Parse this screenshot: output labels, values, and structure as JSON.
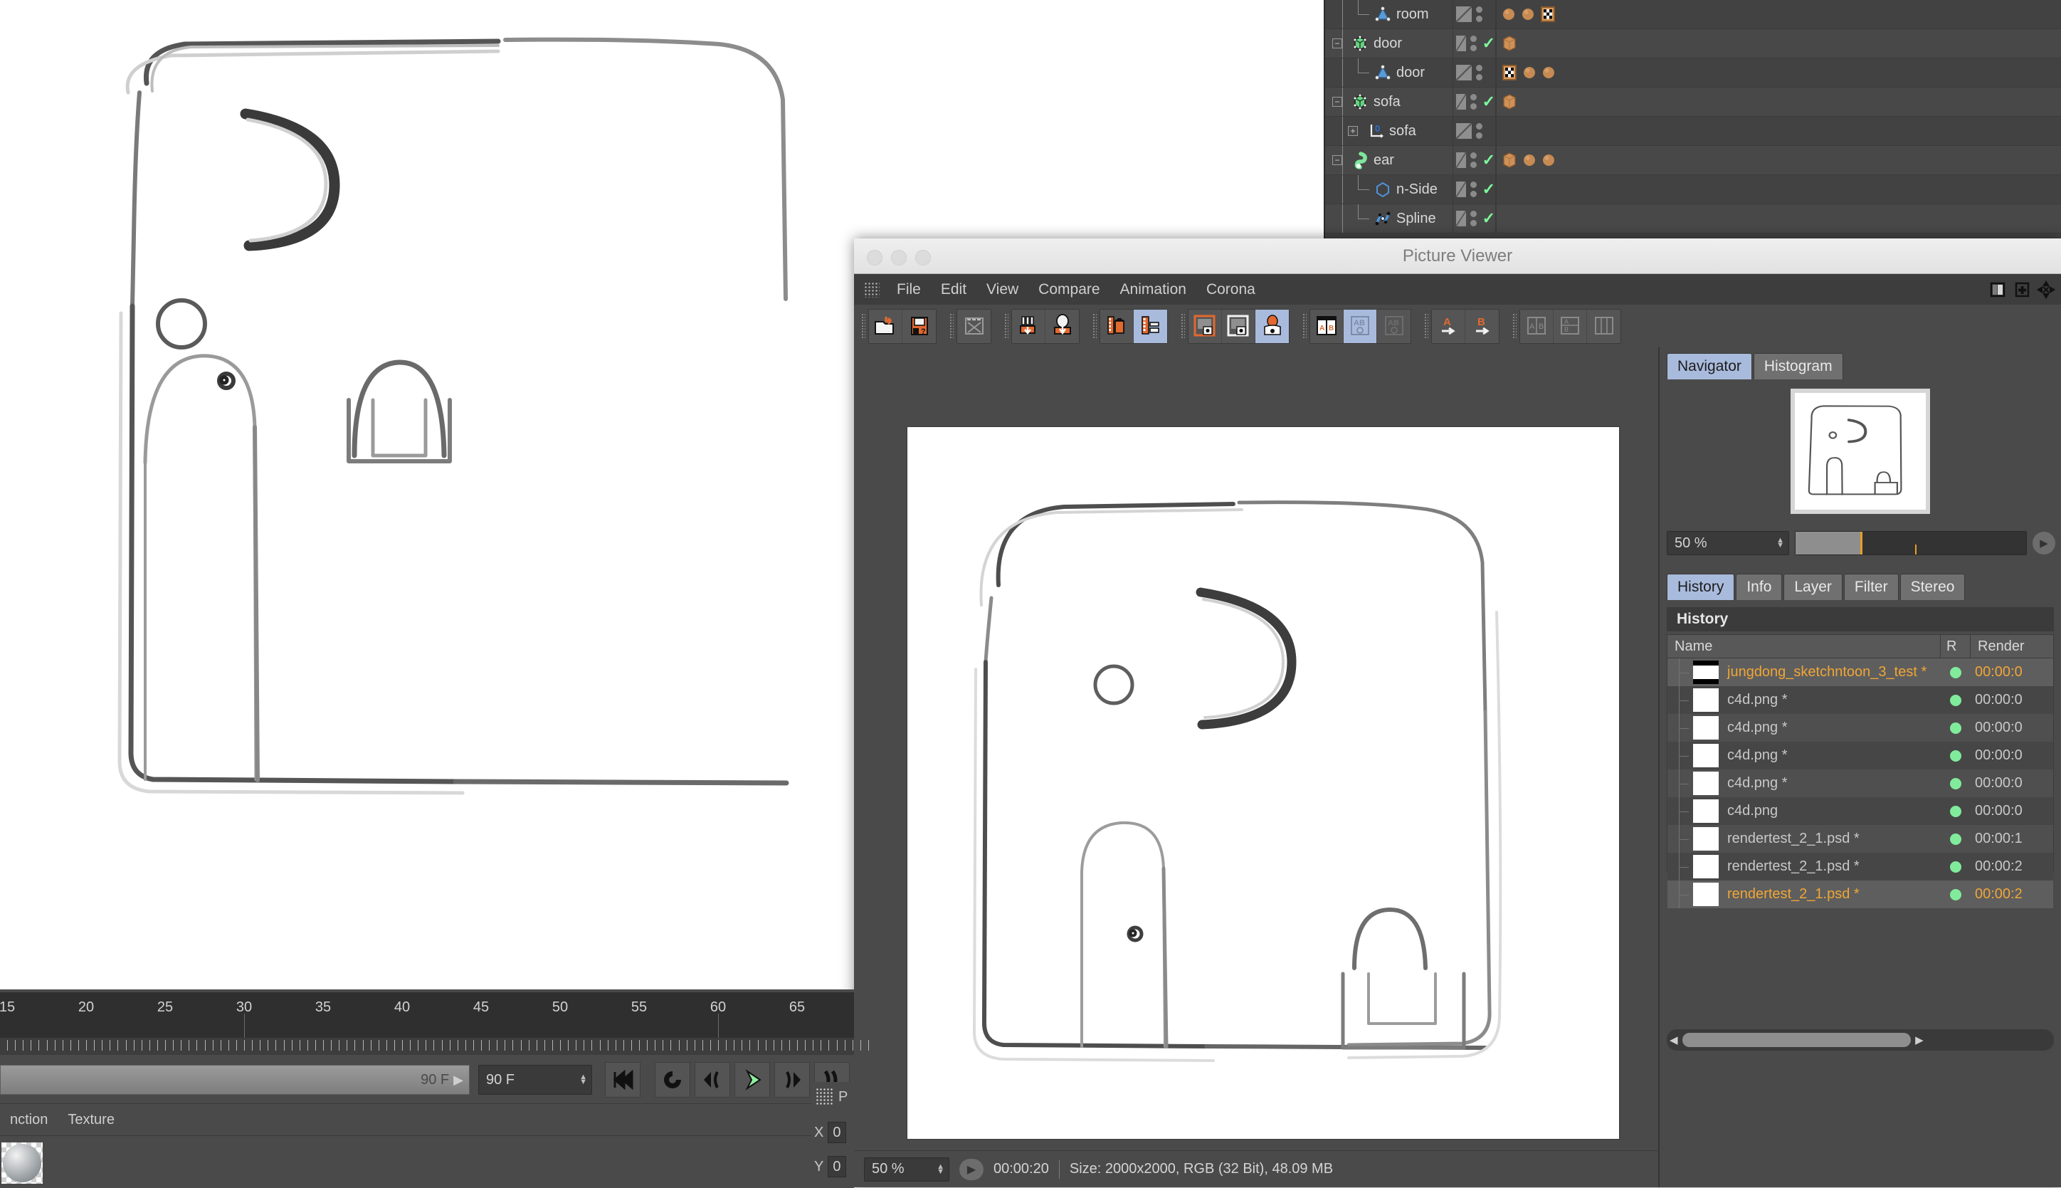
{
  "object_manager": {
    "rows": [
      {
        "label": "room",
        "depth": 2,
        "icon": "polygon-object-icon",
        "expander": "none",
        "check": false,
        "tags": [
          "material-tag",
          "material-tag",
          "texture-checker-tag"
        ]
      },
      {
        "label": "door",
        "depth": 1,
        "icon": "cube-object-icon",
        "expander": "minus",
        "check": true,
        "tags": [
          "texture-cube-tag"
        ]
      },
      {
        "label": "door",
        "depth": 2,
        "icon": "polygon-object-icon",
        "expander": "none",
        "check": false,
        "tags": [
          "texture-checker-tag",
          "material-tag",
          "material-tag"
        ]
      },
      {
        "label": "sofa",
        "depth": 1,
        "icon": "cube-object-icon",
        "expander": "minus",
        "check": true,
        "tags": [
          "texture-cube-tag"
        ]
      },
      {
        "label": "sofa",
        "depth": 2,
        "icon": "null-axis-object-icon",
        "expander": "plus",
        "check": false,
        "tags": []
      },
      {
        "label": "ear",
        "depth": 1,
        "icon": "sweep-object-icon",
        "expander": "minus",
        "check": true,
        "tags": [
          "texture-cube-tag",
          "material-tag",
          "material-tag"
        ]
      },
      {
        "label": "n-Side",
        "depth": 2,
        "icon": "ngon-spline-icon",
        "expander": "none",
        "check": true,
        "tags": []
      },
      {
        "label": "Spline",
        "depth": 2,
        "icon": "spline-object-icon",
        "expander": "none",
        "check": true,
        "tags": []
      }
    ]
  },
  "picture_viewer": {
    "title": "Picture Viewer",
    "menu": [
      "File",
      "Edit",
      "View",
      "Compare",
      "Animation",
      "Corona"
    ],
    "window_right_icons": [
      "split-panel-icon",
      "add-panel-icon",
      "move-panel-icon"
    ],
    "toolbar_groups": [
      {
        "buttons": [
          {
            "name": "open-image-icon",
            "selected": false
          },
          {
            "name": "save-image-icon",
            "selected": false
          }
        ]
      },
      {
        "buttons": [
          {
            "name": "render-region-icon",
            "selected": false
          }
        ]
      },
      {
        "buttons": [
          {
            "name": "load-ab-icon",
            "selected": false
          },
          {
            "name": "load-b-icon",
            "selected": false
          }
        ]
      },
      {
        "buttons": [
          {
            "name": "filmstrip-delete-icon",
            "selected": false
          },
          {
            "name": "filmstrip-edit-icon",
            "selected": true
          }
        ]
      },
      {
        "buttons": [
          {
            "name": "view-fit-icon",
            "selected": false
          },
          {
            "name": "view-original-icon",
            "selected": false
          },
          {
            "name": "view-color-icon",
            "selected": true
          }
        ]
      },
      {
        "buttons": [
          {
            "name": "compare-ab-icon",
            "selected": false
          },
          {
            "name": "compare-ab-blend-icon",
            "selected": true
          },
          {
            "name": "compare-ab-diff-icon",
            "selected": false
          }
        ]
      },
      {
        "buttons": [
          {
            "name": "set-a-icon",
            "selected": false
          },
          {
            "name": "set-b-icon",
            "selected": false
          }
        ]
      },
      {
        "buttons": [
          {
            "name": "layer-a-icon",
            "selected": false
          },
          {
            "name": "layer-b-icon",
            "selected": false
          },
          {
            "name": "layer-c-icon",
            "selected": false
          }
        ]
      }
    ],
    "status": {
      "zoom": "50 %",
      "play_icon": "play-icon",
      "time": "00:00:20",
      "info": "Size: 2000x2000, RGB (32 Bit), 48.09 MB"
    },
    "right_dock": {
      "view_tabs": [
        {
          "label": "Navigator",
          "active": true
        },
        {
          "label": "Histogram",
          "active": false
        }
      ],
      "navigator": {
        "zoom": "50 %",
        "next_icon": "arrow-right-icon"
      },
      "panel_tabs": [
        {
          "label": "History",
          "active": true
        },
        {
          "label": "Info",
          "active": false
        },
        {
          "label": "Layer",
          "active": false
        },
        {
          "label": "Filter",
          "active": false
        },
        {
          "label": "Stereo",
          "active": false
        }
      ],
      "history": {
        "section_title": "History",
        "columns": [
          "Name",
          "R",
          "Render"
        ],
        "rows": [
          {
            "name": "jungdong_sketchntoon_3_test *",
            "r": "green",
            "render": "00:00:0",
            "selected": true,
            "thumb": "blackbars"
          },
          {
            "name": "c4d.png *",
            "r": "green",
            "render": "00:00:0",
            "selected": false,
            "thumb": "plain"
          },
          {
            "name": "c4d.png *",
            "r": "green",
            "render": "00:00:0",
            "selected": false,
            "thumb": "plain"
          },
          {
            "name": "c4d.png *",
            "r": "green",
            "render": "00:00:0",
            "selected": false,
            "thumb": "plain"
          },
          {
            "name": "c4d.png *",
            "r": "green",
            "render": "00:00:0",
            "selected": false,
            "thumb": "plain"
          },
          {
            "name": "c4d.png",
            "r": "green",
            "render": "00:00:0",
            "selected": false,
            "thumb": "plain"
          },
          {
            "name": "rendertest_2_1.psd *",
            "r": "green",
            "render": "00:00:1",
            "selected": false,
            "thumb": "plain"
          },
          {
            "name": "rendertest_2_1.psd *",
            "r": "green",
            "render": "00:00:2",
            "selected": false,
            "thumb": "plain"
          },
          {
            "name": "rendertest_2_1.psd *",
            "r": "green",
            "render": "00:00:2",
            "selected": true,
            "thumb": "plain"
          }
        ]
      }
    }
  },
  "timeline": {
    "labels": [
      "15",
      "20",
      "25",
      "30",
      "35",
      "40",
      "45",
      "50",
      "55",
      "60",
      "65"
    ],
    "range_label": "90 F",
    "frame_field": "90 F",
    "transport": [
      "go-to-start-icon",
      "loop-icon",
      "step-back-icon",
      "play-icon",
      "step-forward-icon",
      "go-to-end-icon"
    ]
  },
  "material_manager": {
    "menu": [
      "nction",
      "Texture"
    ]
  },
  "coordinates": {
    "title": "P",
    "rows": [
      {
        "axis": "X",
        "value": "0"
      },
      {
        "axis": "Y",
        "value": "0"
      }
    ]
  },
  "colors": {
    "panel_bg": "#4a4a4a",
    "panel_dark": "#3b3b3b",
    "accent_selected_tab": "#a9bbdd",
    "accent_orange": "#f0a636",
    "status_green": "#81eb9c",
    "slider_orange": "#e8a020"
  }
}
